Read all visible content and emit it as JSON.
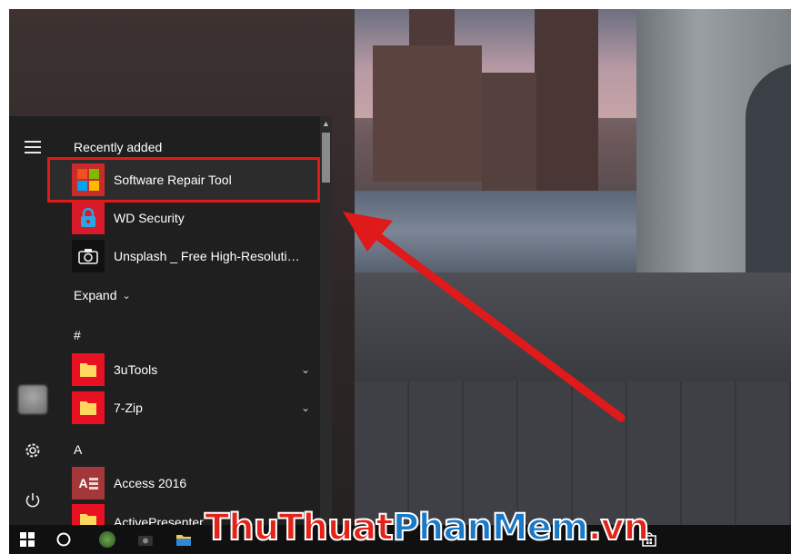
{
  "start_menu": {
    "recently_added_label": "Recently added",
    "recent_apps": [
      {
        "label": "Software Repair Tool",
        "icon": "windows-logo-icon",
        "tile_color": "#c92a2a",
        "highlighted": true
      },
      {
        "label": "WD Security",
        "icon": "lock-icon",
        "tile_color": "#d81b2b"
      },
      {
        "label": "Unsplash _ Free High-Resolution...",
        "icon": "camera-icon",
        "tile_color": "#1a1a1a"
      }
    ],
    "expand_label": "Expand",
    "sections": [
      {
        "header": "#",
        "apps": [
          {
            "label": "3uTools",
            "icon": "folder-icon",
            "tile_color": "#e81123",
            "expandable": true
          },
          {
            "label": "7-Zip",
            "icon": "folder-icon",
            "tile_color": "#e81123",
            "expandable": true
          }
        ]
      },
      {
        "header": "A",
        "apps": [
          {
            "label": "Access 2016",
            "icon": "access-icon",
            "tile_color": "#a4373a",
            "tile_text": "A"
          },
          {
            "label": "ActivePresenter",
            "icon": "folder-icon",
            "tile_color": "#e81123"
          }
        ]
      }
    ],
    "rail": [
      "hamburger-icon",
      "user-avatar",
      "gear-icon",
      "power-icon"
    ]
  },
  "taskbar": {
    "items": [
      "windows-start-icon",
      "cortana-circle-icon",
      "app-icon",
      "camera-icon",
      "file-explorer-icon",
      "store-icon"
    ]
  },
  "watermark": {
    "part1": "ThuThuat",
    "part2": "PhanMem",
    "part3": ".vn"
  },
  "colors": {
    "highlight_border": "#e01a1a",
    "arrow": "#e01a1a",
    "menu_bg": "#1f1f1f"
  }
}
